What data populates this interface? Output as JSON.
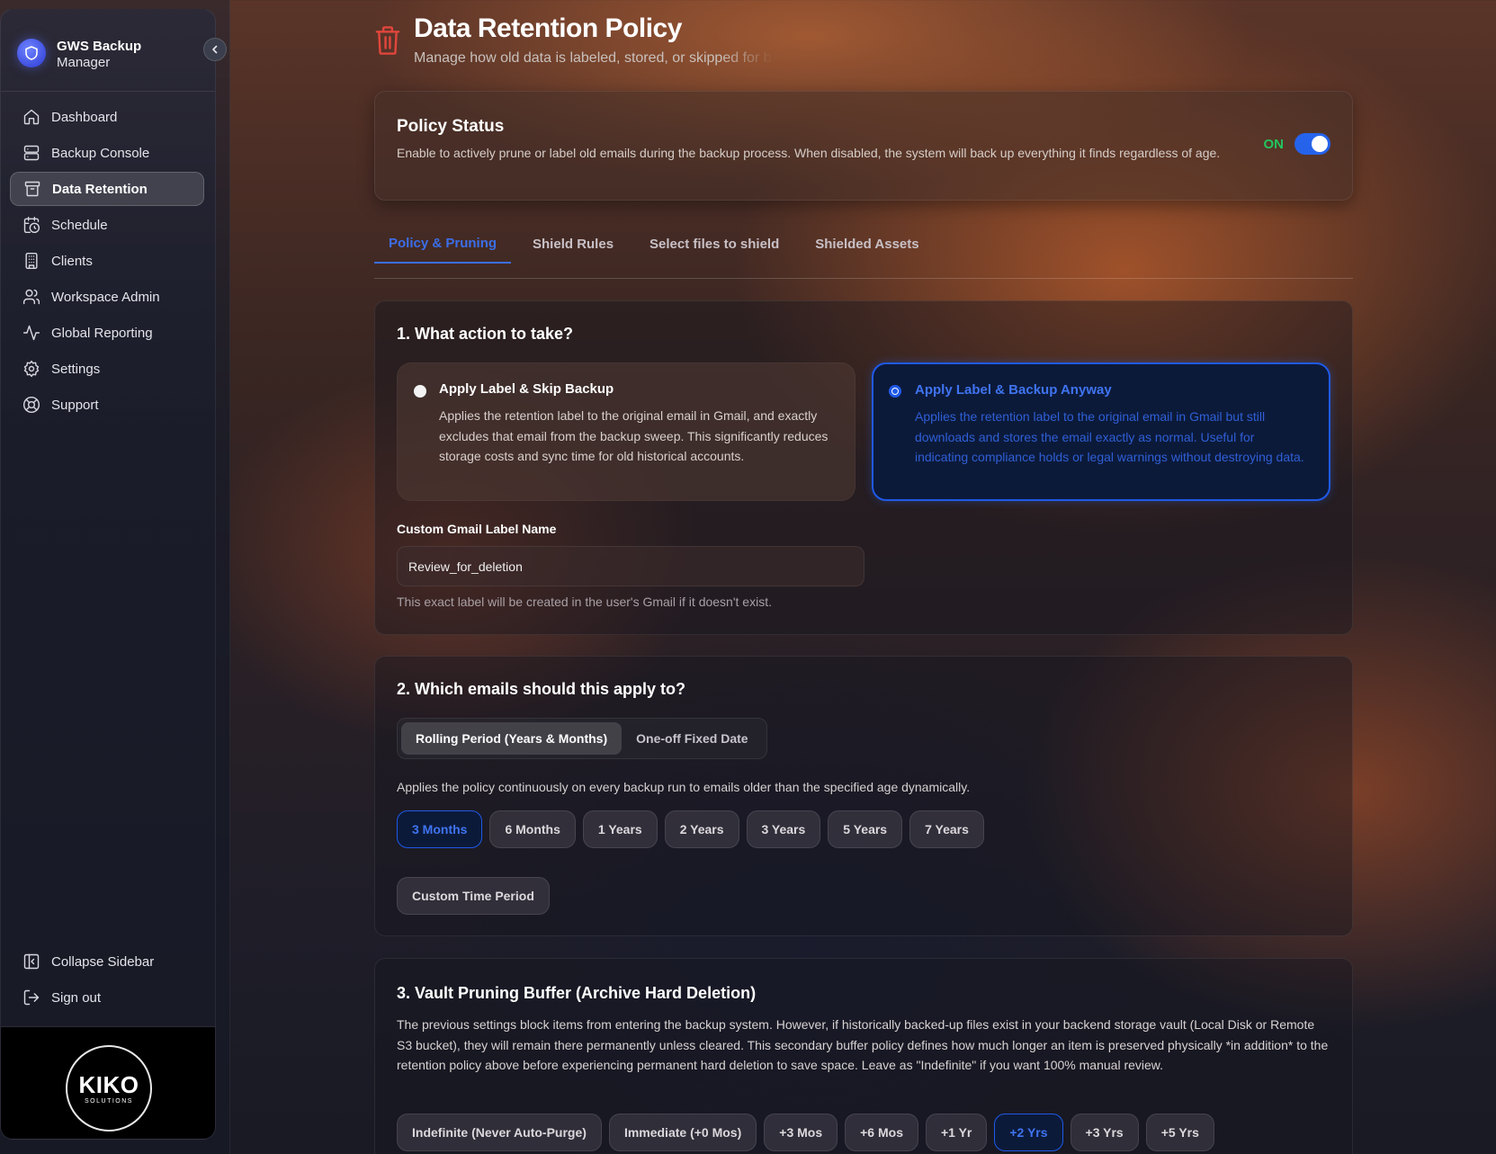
{
  "app": {
    "title_line1": "GWS Backup",
    "title_line2": "Manager"
  },
  "sidebar": {
    "items": [
      {
        "label": "Dashboard",
        "icon": "home-icon"
      },
      {
        "label": "Backup Console",
        "icon": "server-icon"
      },
      {
        "label": "Data Retention",
        "icon": "archive-icon",
        "active": true
      },
      {
        "label": "Schedule",
        "icon": "calendar-clock-icon"
      },
      {
        "label": "Clients",
        "icon": "building-icon"
      },
      {
        "label": "Workspace Admin",
        "icon": "users-icon"
      },
      {
        "label": "Global Reporting",
        "icon": "activity-icon"
      },
      {
        "label": "Settings",
        "icon": "gear-icon"
      },
      {
        "label": "Support",
        "icon": "lifebuoy-icon"
      }
    ],
    "bottom": [
      {
        "label": "Collapse Sidebar",
        "icon": "panel-left-icon"
      },
      {
        "label": "Sign out",
        "icon": "logout-icon"
      }
    ],
    "logo": {
      "main": "KIKO",
      "sub": "SOLUTIONS"
    }
  },
  "page": {
    "title": "Data Retention Policy",
    "subtitle": "Manage how old data is labeled, stored, or skipped for backup"
  },
  "policy_status": {
    "title": "Policy Status",
    "description": "Enable to actively prune or label old emails during the backup process. When disabled, the system will back up everything it finds regardless of age.",
    "toggle_label": "ON",
    "enabled": true
  },
  "tabs": [
    {
      "label": "Policy & Pruning",
      "active": true
    },
    {
      "label": "Shield Rules"
    },
    {
      "label": "Select files to shield"
    },
    {
      "label": "Shielded Assets"
    }
  ],
  "action": {
    "title": "1. What action to take?",
    "options": [
      {
        "title": "Apply Label & Skip Backup",
        "description": "Applies the retention label to the original email in Gmail, and exactly excludes that email from the backup sweep. This significantly reduces storage costs and sync time for old historical accounts.",
        "selected": false
      },
      {
        "title": "Apply Label & Backup Anyway",
        "description": "Applies the retention label to the original email in Gmail but still downloads and stores the email exactly as normal. Useful for indicating compliance holds or legal warnings without destroying data.",
        "selected": true
      }
    ],
    "label_field": {
      "label": "Custom Gmail Label Name",
      "value": "Review_for_deletion",
      "hint": "This exact label will be created in the user's Gmail if it doesn't exist."
    }
  },
  "apply": {
    "title": "2. Which emails should this apply to?",
    "modes": [
      {
        "label": "Rolling Period (Years & Months)",
        "active": true
      },
      {
        "label": "One-off Fixed Date"
      }
    ],
    "description": "Applies the policy continuously on every backup run to emails older than the specified age dynamically.",
    "periods": [
      {
        "label": "3 Months",
        "active": true
      },
      {
        "label": "6 Months"
      },
      {
        "label": "1 Years"
      },
      {
        "label": "2 Years"
      },
      {
        "label": "3 Years"
      },
      {
        "label": "5 Years"
      },
      {
        "label": "7 Years"
      }
    ],
    "custom_label": "Custom Time Period"
  },
  "vault": {
    "title": "3. Vault Pruning Buffer (Archive Hard Deletion)",
    "description": "The previous settings block items from entering the backup system. However, if historically backed-up files exist in your backend storage vault (Local Disk or Remote S3 bucket), they will remain there permanently unless cleared. This secondary buffer policy defines how much longer an item is preserved physically *in addition* to the retention policy above before experiencing permanent hard deletion to save space. Leave as \"Indefinite\" if you want 100% manual review.",
    "buffers": [
      {
        "label": "Indefinite (Never Auto-Purge)"
      },
      {
        "label": "Immediate (+0 Mos)"
      },
      {
        "label": "+3 Mos"
      },
      {
        "label": "+6 Mos"
      },
      {
        "label": "+1 Yr"
      },
      {
        "label": "+2 Yrs",
        "active": true
      },
      {
        "label": "+3 Yrs"
      },
      {
        "label": "+5 Yrs"
      }
    ]
  },
  "colors": {
    "accent": "#2563eb",
    "danger": "#e0463c",
    "success": "#22c55e"
  }
}
